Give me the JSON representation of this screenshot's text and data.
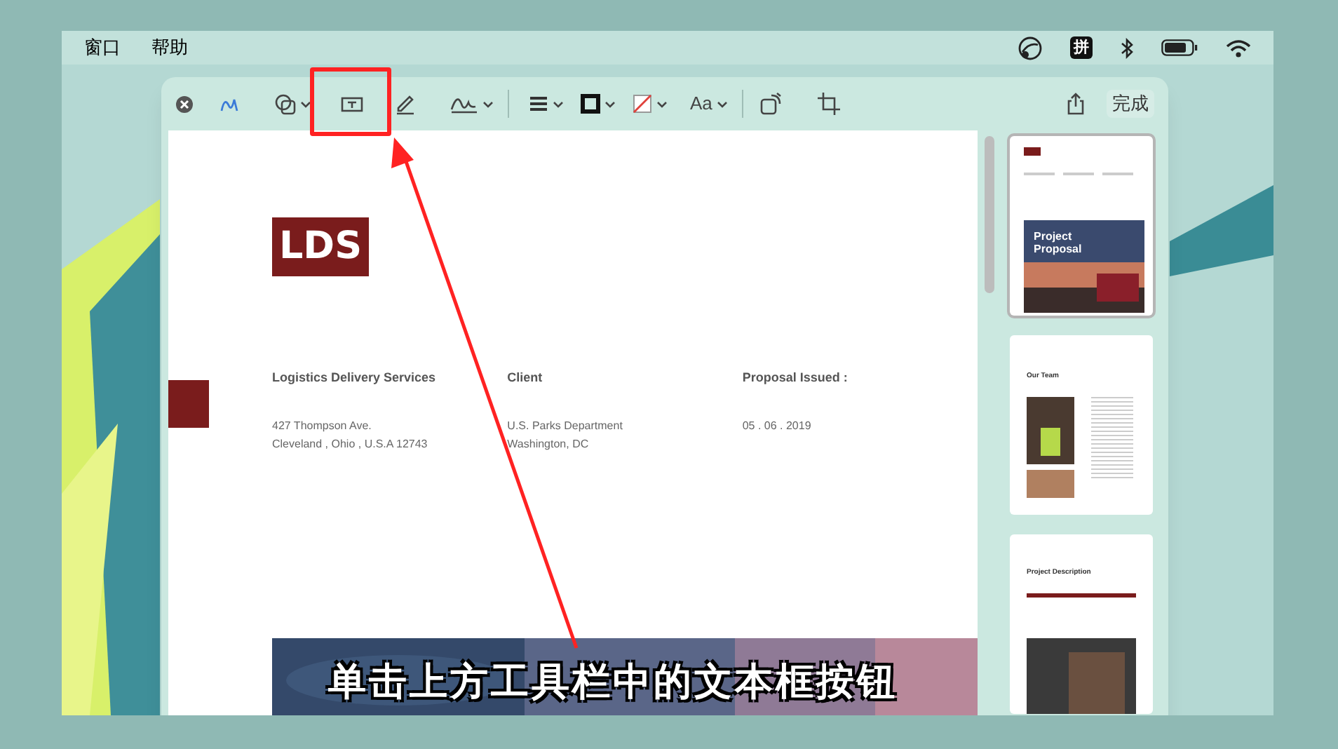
{
  "menu_bar": {
    "items": [
      "窗口",
      "帮助"
    ],
    "input_method": "拼"
  },
  "toolbar": {
    "font_button": "Aa",
    "done_button": "完成"
  },
  "document": {
    "logo": "LDS",
    "columns": [
      {
        "heading": "Logistics Delivery Services",
        "lines": [
          "427 Thompson Ave.",
          "Cleveland , Ohio , U.S.A 12743"
        ]
      },
      {
        "heading": "Client",
        "lines": [
          "U.S. Parks Department",
          "Washington, DC"
        ]
      },
      {
        "heading": "Proposal Issued :",
        "lines": [
          "05 . 06 . 2019"
        ]
      }
    ]
  },
  "thumbnails": [
    {
      "kind": "cover",
      "title": "Project Proposal",
      "selected": true
    },
    {
      "kind": "team",
      "title": "Our Team",
      "selected": false
    },
    {
      "kind": "description",
      "title": "Project Description",
      "selected": false
    }
  ],
  "caption": "单击上方工具栏中的文本框按钮"
}
